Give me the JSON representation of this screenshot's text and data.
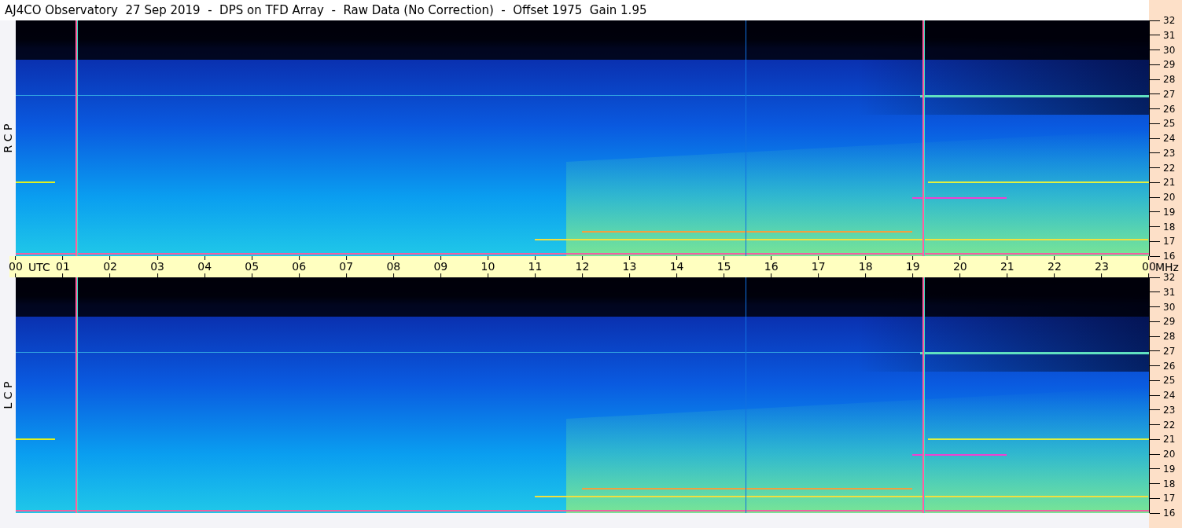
{
  "title": "AJ4CO Observatory  27 Sep 2019  -  DPS on TFD Array  -  Raw Data (No Correction)  -  Offset 1975  Gain 1.95",
  "panels": [
    {
      "label": "R C P",
      "freq_labels": [
        "32",
        "31",
        "30",
        "29",
        "28",
        "27",
        "26",
        "25",
        "24",
        "23",
        "22",
        "21",
        "20",
        "19",
        "18",
        "17",
        "16"
      ]
    },
    {
      "label": "L C P",
      "freq_labels": [
        "32",
        "31",
        "30",
        "29",
        "28",
        "27",
        "26",
        "25",
        "24",
        "23",
        "22",
        "21",
        "20",
        "19",
        "18",
        "17",
        "16"
      ]
    }
  ],
  "time_axis": {
    "labels": [
      "00",
      "01",
      "02",
      "03",
      "04",
      "05",
      "06",
      "07",
      "08",
      "09",
      "10",
      "11",
      "12",
      "13",
      "14",
      "15",
      "16",
      "17",
      "18",
      "19",
      "20",
      "21",
      "22",
      "23",
      "00"
    ],
    "zone": "UTC",
    "unit": "MHz"
  }
}
